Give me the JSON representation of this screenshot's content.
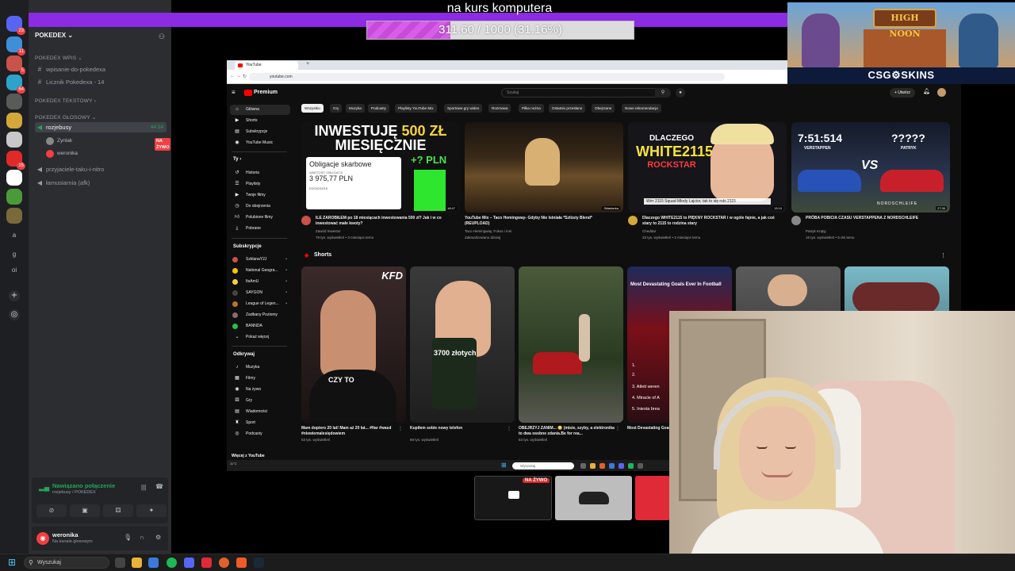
{
  "overlay": {
    "goal_title": "na kurs komputera",
    "progress_text": "311.60 / 1000 (31.16%)",
    "progress_fraction": 0.3116,
    "ad_sign": "HIGH NOON",
    "ad_logo": "CSG⚙SKINS",
    "mini_live_badge": "NA ŻYWO"
  },
  "discord": {
    "server_name": "POKEDEX",
    "server_badges": [
      "23",
      "11",
      "5",
      "64",
      "15"
    ],
    "rail_letters": [
      "a",
      "g",
      "oi"
    ],
    "categories": {
      "wpis": "POKEDEX Wpis",
      "tekstowy": "POKEDEX Tekstowy",
      "glosowy": "POKEDEX GŁOSOWY"
    },
    "channels": {
      "wpisanie": "wpisanie-do-pokedexa",
      "licznik": "Licznik Pokedexa - 14",
      "rozjebusy": "rozjebusy",
      "rozjebusy_timer": "44:24",
      "przyjaciele": "przyjaciele-taku-i-nitro",
      "lamusiarnia": "łamusiarnia (afk)"
    },
    "voice_users": [
      {
        "name": "Zynlak",
        "live": ""
      },
      {
        "name": "weronika",
        "live": "NA ŻYWO"
      }
    ],
    "voice_status": "Nawiązano połączenie",
    "voice_sub": "rozjebusy / POKEDEX",
    "user_name": "weronika",
    "user_status": "Na kanale głosowym"
  },
  "taskbar": {
    "search_placeholder": "Wyszukaj"
  },
  "browser": {
    "tab_title": "YouTube",
    "url": "youtube.com",
    "yt_logo": "Premium",
    "search_placeholder": "Szukaj",
    "create_label": "+ Utwórz",
    "sidebar": {
      "main": [
        "Główna",
        "Shorts",
        "Subskrypcje",
        "YouTube Music"
      ],
      "you_heading": "Ty",
      "you": [
        "Historia",
        "Playlisty",
        "Twoje filmy",
        "Do obejrzenia",
        "Polubione filmy",
        "Pobrane"
      ],
      "subs_heading": "Subskrypcje",
      "subs": [
        "SzklanaY2J",
        "National Geogra...",
        "ItsAmU",
        "SAYGON",
        "League of Legen...",
        "Zadbany Poziomy",
        "BANNDA"
      ],
      "show_more": "Pokaż więcej",
      "explore_heading": "Odkrywaj",
      "explore": [
        "Muzyka",
        "Filmy",
        "Na żywo",
        "Gry",
        "Wiadomości",
        "Sport",
        "Podcasty"
      ],
      "more_heading": "Więcej z YouTube"
    },
    "chips": [
      "Wszystko",
      "Gry",
      "Muzyka",
      "Podcasty",
      "Playlisty YouTube Mix",
      "Sportowe gry wideo",
      "Rozmowa",
      "Piłka nożna",
      "Ostatnio przesłane",
      "Obejrzane",
      "Nowe rekomendacje"
    ],
    "videos": [
      {
        "title": "ILE ZAROBIŁEM po 18 miesiącach inwestowania 500 zł? Jak i w co inwestować małe kwoty?",
        "channel": "Zawód Inwestor",
        "stats": "79 tys. wyświetleń • 3 miesiące temu",
        "duration": "18:47",
        "thumb_line1": "INWESTUJĘ ",
        "thumb_highlight": "500 ZŁ",
        "thumb_line2": "MIESIĘCZNIE",
        "card_title": "Obligacje skarbowe",
        "card_sub": "WARTOŚĆ OBLIGACJI",
        "card_value": "3 975,77 PLN",
        "card_foot": "EDO0234/16",
        "pln": "+? PLN"
      },
      {
        "title": "YouTube Mix – Taco Hemingway- Gdyby Nie Istniała *Szlüsty Blend* (REUPLOAD)",
        "channel": "Taco Hemingway, Fokus i inni",
        "stats": "Zaktualizowano dzisiaj",
        "duration": "Składanka"
      },
      {
        "title": "Dlaczego WHITE2115 to PIĘKNY ROCKSTAR i w ogóle fajnie, a jak coś stary to 2115 to rodzina stary",
        "channel": "Cheddar",
        "stats": "33 tys. wyświetleń • 2 miesiące temu",
        "duration": "13:10",
        "thumb_l1": "DLACZEGO",
        "thumb_l2": "WHITE2115",
        "thumb_l3": "ROCKSTAR",
        "caption": "Wrrr 2115 Squad Młody Lajcior, tak to się robi 2115"
      },
      {
        "title": "PRÓBA POBICIA CZASU VERSTAPPENA Z NORDSCHLEIFE",
        "channel": "Patryk Krątyj",
        "stats": "15 tys. wyświetleń • 5 dni temu",
        "duration": "27:30",
        "time": "7:51:514",
        "name1": "VERSTAPPEN",
        "question": "?????",
        "name2": "PATRYK",
        "vs": "VS",
        "ring": "NORDSCHLEIFE"
      }
    ],
    "shorts_heading": "Shorts",
    "shorts": [
      {
        "title": "Mam dopiero 20 lat! Mam aż 20 lat... #fiar #wasd #niewiemalesiędowiem",
        "views": "53 tys. wyświetleń",
        "cap": "CZY TO",
        "kfd": "KFD"
      },
      {
        "title": "Kupiłem sobie nowy telefon",
        "views": "68 tys. wyświetleń",
        "cap": "3700 złotych"
      },
      {
        "title": "OBEJRZYJ ZANIM... 😳 (misie, szyby, a elektronika to dwa osobne zdania.Be for rea...",
        "views": "63 tys. wyświetleń"
      },
      {
        "title": "Most Devastating Goals Ever In Football",
        "views": "",
        "cap": "Most Devastating Goals Ever In Football",
        "list": [
          "1.",
          "2.",
          "3. Atleti weren",
          "4. Miracle of A",
          "5. Iniesta brea"
        ]
      },
      {
        "title": "",
        "views": ""
      },
      {
        "title": "",
        "views": ""
      }
    ],
    "inner_search": "Wyszukaj",
    "weather": "11°C"
  },
  "colors": {
    "discord_bg": "#2b2d31",
    "discord_green": "#23a559",
    "discord_red": "#f23f42",
    "yt_bg": "#0f0f0f",
    "goal_purple": "#8b2be2"
  }
}
